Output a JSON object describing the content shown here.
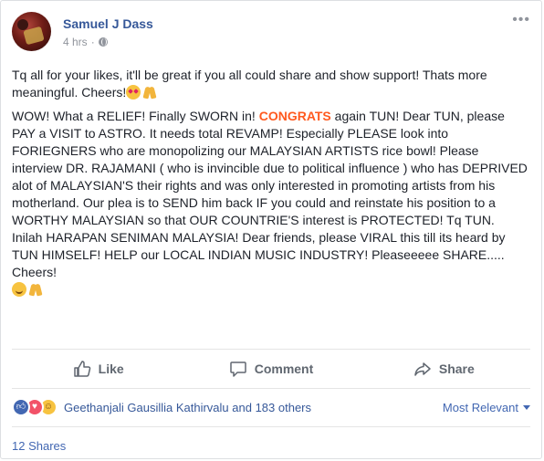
{
  "post": {
    "author": "Samuel J Dass",
    "time": "4 hrs",
    "separator": "·",
    "more_label": "•••",
    "para1": "Tq all for your likes, it'll be great if you all could share and show support! Thats more meaningful. Cheers!",
    "para2_part1": "WOW! What a RELIEF! Finally SWORN in! ",
    "para2_highlight": "CONGRATS",
    "para2_part2": " again TUN! Dear TUN, please PAY a VISIT to ASTRO. It needs total REVAMP! Especially PLEASE look into FORIEGNERS who are monopolizing our MALAYSIAN ARTISTS rice bowl! Please interview DR. RAJAMANI ( who is invincible due to political influence ) who has DEPRIVED alot of MALAYSIAN'S their rights and was only interested in promoting artists from his motherland. Our plea is to SEND him back IF you could and reinstate his position to a WORTHY MALAYSIAN so that OUR COUNTRIE'S interest is PROTECTED! Tq TUN. Inilah HARAPAN SENIMAN MALAYSIA! Dear friends, please VIRAL this till its heard by TUN HIMSELF! HELP our LOCAL INDIAN MUSIC INDUSTRY! Pleaseeeee SHARE..... Cheers!",
    "highlight_color": "#ff5a1f"
  },
  "actions": {
    "like": "Like",
    "comment": "Comment",
    "share": "Share"
  },
  "reactions": {
    "icons": [
      "like-reaction",
      "love-reaction",
      "haha-reaction"
    ],
    "names": "Geethanjali Gausillia Kathirvalu and 183 others",
    "sort_label": "Most Relevant"
  },
  "shares_count": "12 Shares",
  "colors": {
    "link": "#365899",
    "accent": "#4267b2",
    "muted": "#90949c"
  }
}
